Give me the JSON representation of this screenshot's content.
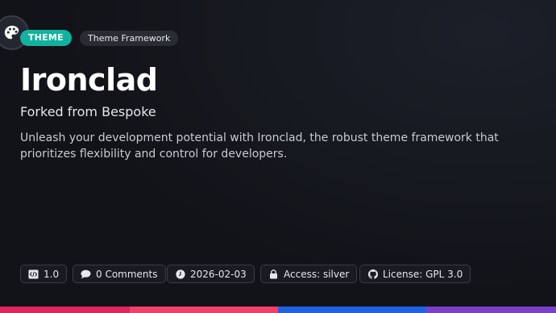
{
  "badges": {
    "type_label": "THEME",
    "category_label": "Theme Framework"
  },
  "header": {
    "title": "Ironclad",
    "subtitle": "Forked from Bespoke",
    "description": "Unleash your development potential with Ironclad, the robust theme framework that prioritizes flexibility and control for developers."
  },
  "meta": {
    "version": "1.0",
    "comments": "0 Comments",
    "date": "2026-02-03",
    "access": "Access: silver",
    "license": "License: GPL 3.0"
  },
  "icons": {
    "header": "palette-icon",
    "version": "code-icon",
    "comments": "speech-bubble-icon",
    "date": "clock-icon",
    "access": "lock-icon",
    "license": "github-icon"
  },
  "colors": {
    "background": "#15161d",
    "theme_badge": "#12b39e",
    "category_badge": "#2a2c34",
    "bar_red": "#e0245e",
    "bar_pink": "#f43f6b",
    "bar_blue": "#1e63e6",
    "bar_purple": "#7b3fc8"
  }
}
